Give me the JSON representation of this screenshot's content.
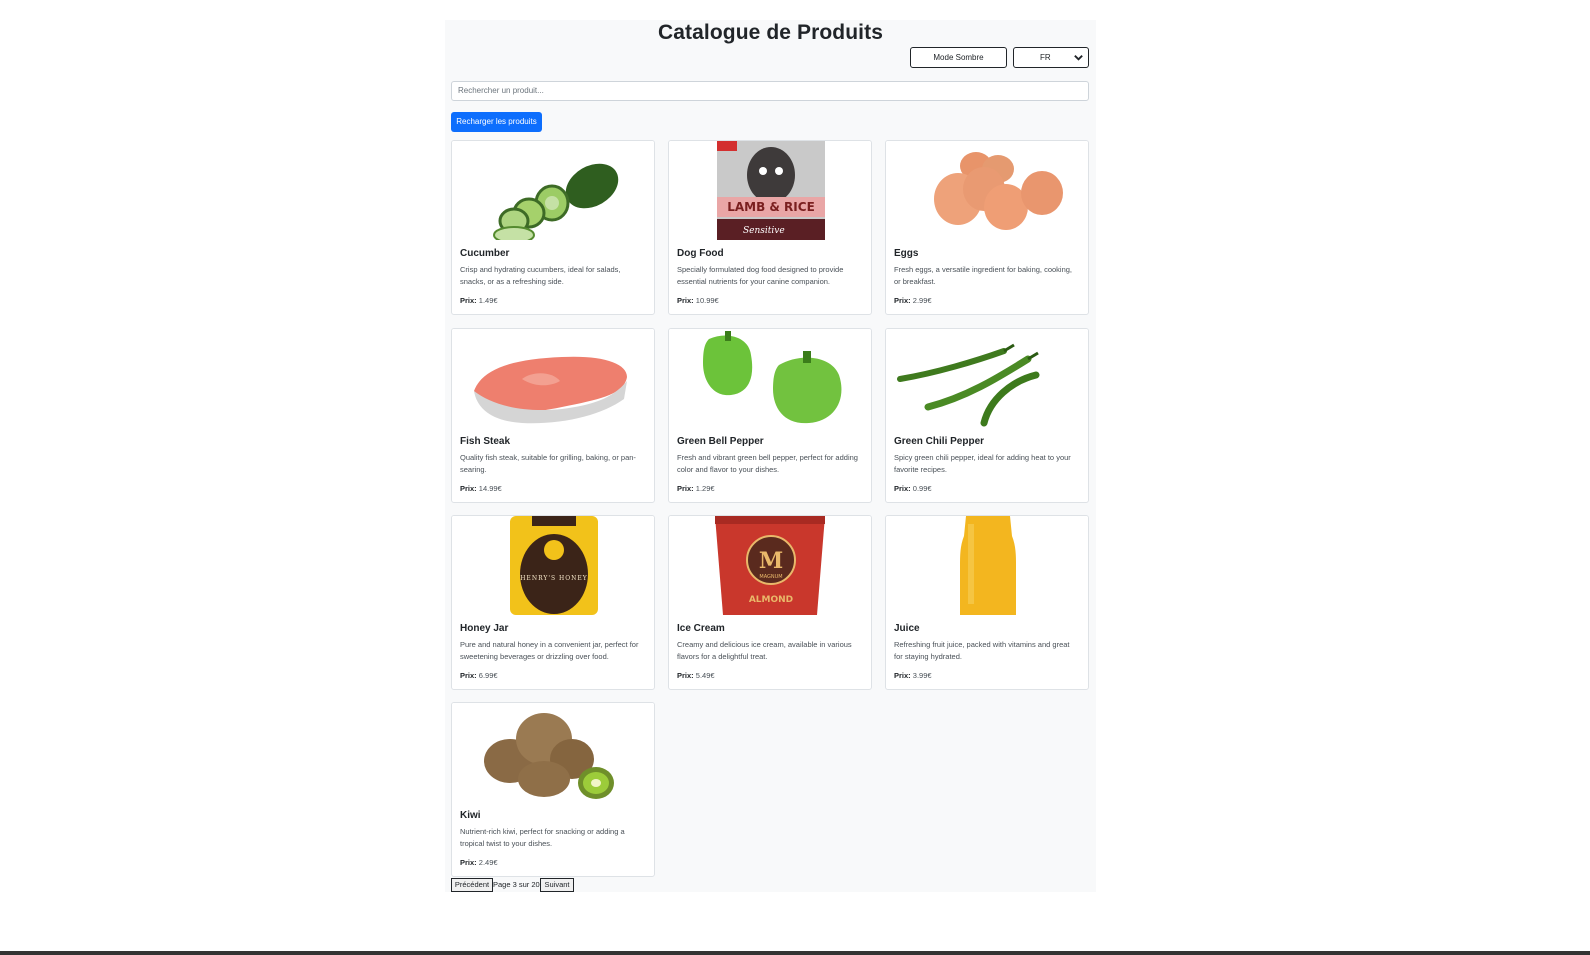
{
  "page": {
    "title": "Catalogue de Produits",
    "dark_mode_label": "Mode Sombre",
    "language": "FR",
    "search_placeholder": "Rechercher un produit...",
    "reload_label": "Recharger les produits",
    "price_label": "Prix:"
  },
  "products": [
    {
      "name": "Cucumber",
      "desc": "Crisp and hydrating cucumbers, ideal for salads, snacks, or as a refreshing side.",
      "price": "1.49€"
    },
    {
      "name": "Dog Food",
      "desc": "Specially formulated dog food designed to provide essential nutrients for your canine companion.",
      "price": "10.99€"
    },
    {
      "name": "Eggs",
      "desc": "Fresh eggs, a versatile ingredient for baking, cooking, or breakfast.",
      "price": "2.99€"
    },
    {
      "name": "Fish Steak",
      "desc": "Quality fish steak, suitable for grilling, baking, or pan-searing.",
      "price": "14.99€"
    },
    {
      "name": "Green Bell Pepper",
      "desc": "Fresh and vibrant green bell pepper, perfect for adding color and flavor to your dishes.",
      "price": "1.29€"
    },
    {
      "name": "Green Chili Pepper",
      "desc": "Spicy green chili pepper, ideal for adding heat to your favorite recipes.",
      "price": "0.99€"
    },
    {
      "name": "Honey Jar",
      "desc": "Pure and natural honey in a convenient jar, perfect for sweetening beverages or drizzling over food.",
      "price": "6.99€"
    },
    {
      "name": "Ice Cream",
      "desc": "Creamy and delicious ice cream, available in various flavors for a delightful treat.",
      "price": "5.49€"
    },
    {
      "name": "Juice",
      "desc": "Refreshing fruit juice, packed with vitamins and great for staying hydrated.",
      "price": "3.99€"
    },
    {
      "name": "Kiwi",
      "desc": "Nutrient-rich kiwi, perfect for snacking or adding a tropical twist to your dishes.",
      "price": "2.49€"
    }
  ],
  "image_text": {
    "dog_food": "LAMB & RICE",
    "dog_food_sub": "Sensitive",
    "honey": "HENRY'S HONEY",
    "ice_cream": "MAGNUM",
    "ice_cream_sub": "ALMOND"
  },
  "pagination": {
    "prev_label": "Précédent",
    "info": "Page 3 sur 20",
    "next_label": "Suivant"
  }
}
